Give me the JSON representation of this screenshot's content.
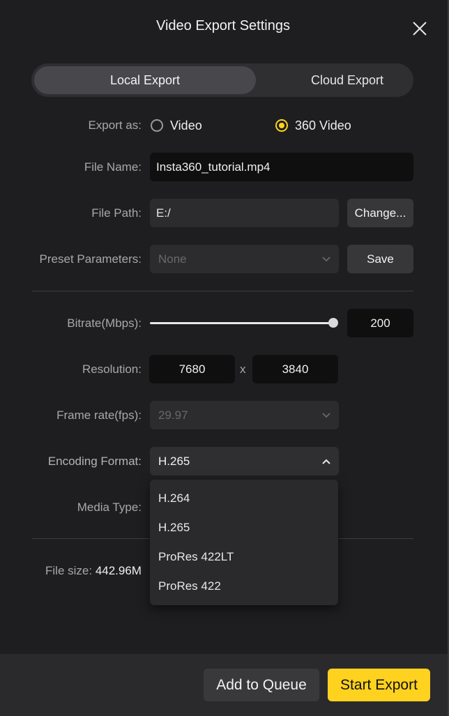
{
  "dialog": {
    "title": "Video Export Settings"
  },
  "tabs": [
    {
      "label": "Local Export",
      "active": true
    },
    {
      "label": "Cloud Export",
      "active": false
    }
  ],
  "export_as": {
    "label": "Export as:",
    "options": [
      {
        "label": "Video",
        "selected": false
      },
      {
        "label": "360 Video",
        "selected": true
      }
    ]
  },
  "file_name": {
    "label": "File Name:",
    "value": "Insta360_tutorial.mp4"
  },
  "file_path": {
    "label": "File Path:",
    "value": "E:/",
    "button": "Change..."
  },
  "preset": {
    "label": "Preset Parameters:",
    "value": "None",
    "button": "Save"
  },
  "bitrate": {
    "label": "Bitrate(Mbps):",
    "value": "200",
    "level": 1.0
  },
  "resolution": {
    "label": "Resolution:",
    "width": "7680",
    "separator": "x",
    "height": "3840"
  },
  "frame_rate": {
    "label": "Frame rate(fps):",
    "value": "29.97"
  },
  "encoding": {
    "label": "Encoding Format:",
    "value": "H.265",
    "options": [
      "H.264",
      "H.265",
      "ProRes 422LT",
      "ProRes 422"
    ]
  },
  "media_type": {
    "label": "Media Type:"
  },
  "file_size": {
    "label": "File size:",
    "value": "442.96M"
  },
  "footer": {
    "queue_button": "Add to Queue",
    "export_button": "Start Export"
  },
  "colors": {
    "accent": "#ffd21f",
    "background": "#1e1e20",
    "field": "#0f0f10"
  },
  "icons": {
    "close": "close-icon",
    "chevron_down": "chevron-down-icon",
    "chevron_up": "chevron-up-icon"
  }
}
